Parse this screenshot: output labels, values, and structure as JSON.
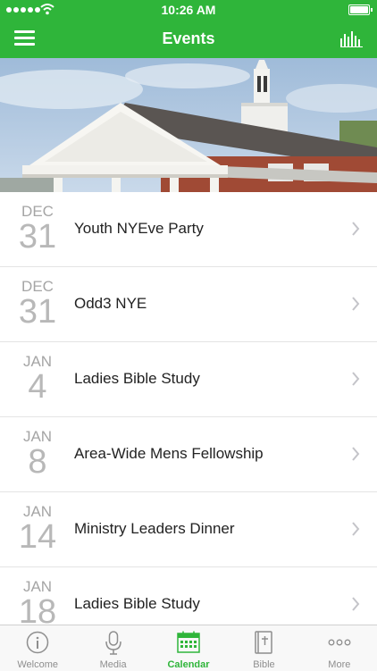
{
  "status_bar": {
    "time": "10:26 AM"
  },
  "nav": {
    "title": "Events"
  },
  "events": [
    {
      "month": "DEC",
      "day": "31",
      "title": "Youth NYEve Party"
    },
    {
      "month": "DEC",
      "day": "31",
      "title": "Odd3 NYE"
    },
    {
      "month": "JAN",
      "day": "4",
      "title": "Ladies Bible Study"
    },
    {
      "month": "JAN",
      "day": "8",
      "title": "Area-Wide Mens Fellowship"
    },
    {
      "month": "JAN",
      "day": "14",
      "title": "Ministry Leaders Dinner"
    },
    {
      "month": "JAN",
      "day": "18",
      "title": "Ladies Bible Study"
    }
  ],
  "tabs": [
    {
      "label": "Welcome",
      "icon": "info-icon"
    },
    {
      "label": "Media",
      "icon": "microphone-icon"
    },
    {
      "label": "Calendar",
      "icon": "calendar-icon",
      "active": true
    },
    {
      "label": "Bible",
      "icon": "bible-icon"
    },
    {
      "label": "More",
      "icon": "more-icon"
    }
  ],
  "colors": {
    "accent": "#2fb53a",
    "tab_inactive": "#8e8e8e",
    "date_gray": "#b0b0b0"
  }
}
